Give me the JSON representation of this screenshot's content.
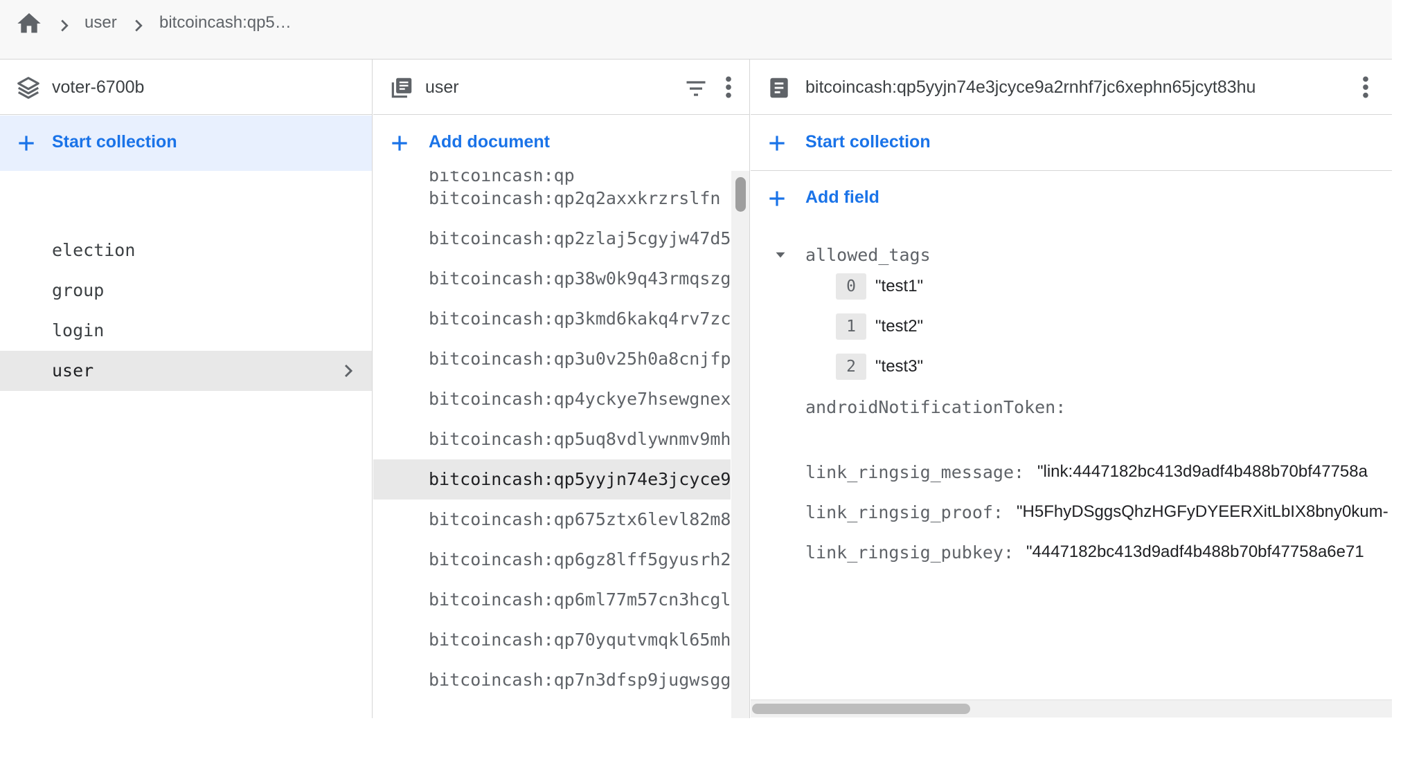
{
  "breadcrumb": {
    "items": [
      "user",
      "bitcoincash:qp5…"
    ]
  },
  "project_panel": {
    "title": "voter-6700b",
    "start_collection_label": "Start collection",
    "collections": [
      "election",
      "group",
      "login",
      "user"
    ],
    "selected": "user"
  },
  "collection_panel": {
    "title": "user",
    "add_document_label": "Add document",
    "documents": [
      "bitcoincash:qp2q2axxkrzrslfn",
      "bitcoincash:qp2zlaj5cgyjw47d5",
      "bitcoincash:qp38w0k9q43rmqszg",
      "bitcoincash:qp3kmd6kakq4rv7zc",
      "bitcoincash:qp3u0v25h0a8cnjfp",
      "bitcoincash:qp4yckye7hsewgnex",
      "bitcoincash:qp5uq8vdlywnmv9mh",
      "bitcoincash:qp5yyjn74e3jcyce9",
      "bitcoincash:qp675ztx6levl82m8",
      "bitcoincash:qp6gz8lff5gyusrh2",
      "bitcoincash:qp6ml77m57cn3hcgl",
      "bitcoincash:qp70yqutvmqkl65mh",
      "bitcoincash:qp7n3dfsp9jugwsgg"
    ],
    "partial_top": "bitcoincash:qp",
    "selected_index": 7
  },
  "document_panel": {
    "title": "bitcoincash:qp5yyjn74e3jcyce9a2rnhf7jc6xephn65jcyt83hu",
    "start_collection_label": "Start collection",
    "add_field_label": "Add field",
    "allowed_tags": {
      "key": "allowed_tags",
      "items": [
        {
          "index": "0",
          "value": "\"test1\""
        },
        {
          "index": "1",
          "value": "\"test2\""
        },
        {
          "index": "2",
          "value": "\"test3\""
        }
      ]
    },
    "fields": [
      {
        "key": "androidNotificationToken:",
        "value": ""
      },
      {
        "key": "link_ringsig_message:",
        "value": "\"link:4447182bc413d9adf4b488b70bf47758a"
      },
      {
        "key": "link_ringsig_proof:",
        "value": "\"H5FhyDSggsQhzHGFyDYEERXitLbIX8bny0kum-"
      },
      {
        "key": "link_ringsig_pubkey:",
        "value": "\"4447182bc413d9adf4b488b70bf47758a6e71"
      }
    ]
  },
  "colors": {
    "accent": "#1a73e8",
    "selected_bg": "#e8e8e8",
    "highlight_bg": "#e8f0fe"
  }
}
